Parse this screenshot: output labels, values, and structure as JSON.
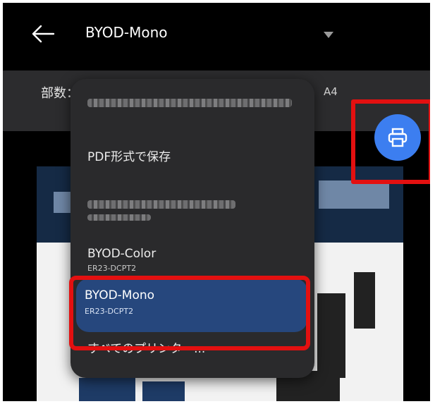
{
  "header": {
    "title": "BYOD-Mono",
    "back_icon": "arrow-left-icon",
    "dropdown_icon": "triangle-down-icon"
  },
  "settings": {
    "copies_label": "部数：",
    "paper_size": "A4"
  },
  "printer_menu": {
    "items": [
      {
        "name": "PDF形式で保存"
      },
      {
        "name": "BYOD-Color",
        "sub": "ER23-DCPT2"
      },
      {
        "name": "BYOD-Mono",
        "sub": "ER23-DCPT2",
        "selected": true
      },
      {
        "name": "すべてのプリンター..."
      }
    ]
  },
  "fab": {
    "icon": "printer-icon",
    "color": "#3c7ef0"
  },
  "colors": {
    "highlight": "#e31010",
    "selected_bg": "#26477d",
    "menu_bg": "#2a2a2c"
  }
}
